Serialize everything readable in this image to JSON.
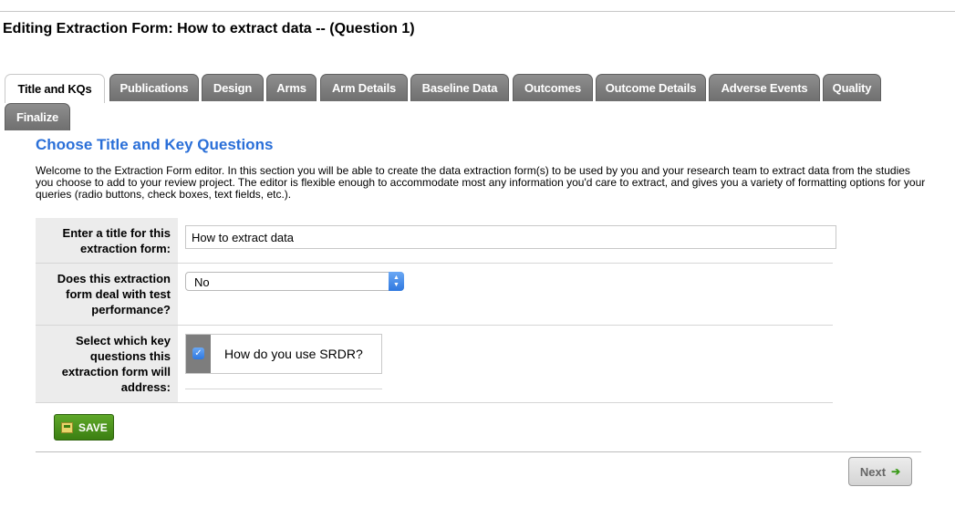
{
  "page": {
    "title": "Editing Extraction Form: How to extract data -- (Question 1)"
  },
  "tabs": [
    {
      "label": "Title and KQs",
      "active": true
    },
    {
      "label": "Publications",
      "active": false
    },
    {
      "label": "Design",
      "active": false
    },
    {
      "label": "Arms",
      "active": false
    },
    {
      "label": "Arm Details",
      "active": false
    },
    {
      "label": "Baseline Data",
      "active": false
    },
    {
      "label": "Outcomes",
      "active": false
    },
    {
      "label": "Outcome Details",
      "active": false
    },
    {
      "label": "Adverse Events",
      "active": false
    },
    {
      "label": "Quality",
      "active": false
    },
    {
      "label": "Finalize",
      "active": false
    }
  ],
  "section": {
    "title": "Choose Title and Key Questions",
    "intro": "Welcome to the Extraction Form editor. In this section you will be able to create the data extraction form(s) to be used by you and your research team to extract data from the studies you choose to add to your review project. The editor is flexible enough to accommodate most any information you'd care to extract, and gives you a variety of formatting options for your queries (radio buttons, check boxes, text fields, etc.)."
  },
  "form": {
    "title_label": "Enter a title for this extraction form:",
    "title_value": "How to extract data",
    "test_label": "Does this extraction form deal with test performance?",
    "test_value": "No",
    "kq_label": "Select which key questions this extraction form will address:",
    "key_questions": [
      {
        "label": "How do you use SRDR?",
        "checked": true
      }
    ]
  },
  "buttons": {
    "save": "SAVE",
    "next": "Next"
  },
  "colors": {
    "accent": "#2a6fd8",
    "save": "#4a8f1f",
    "tab": "#7a7a7a"
  }
}
